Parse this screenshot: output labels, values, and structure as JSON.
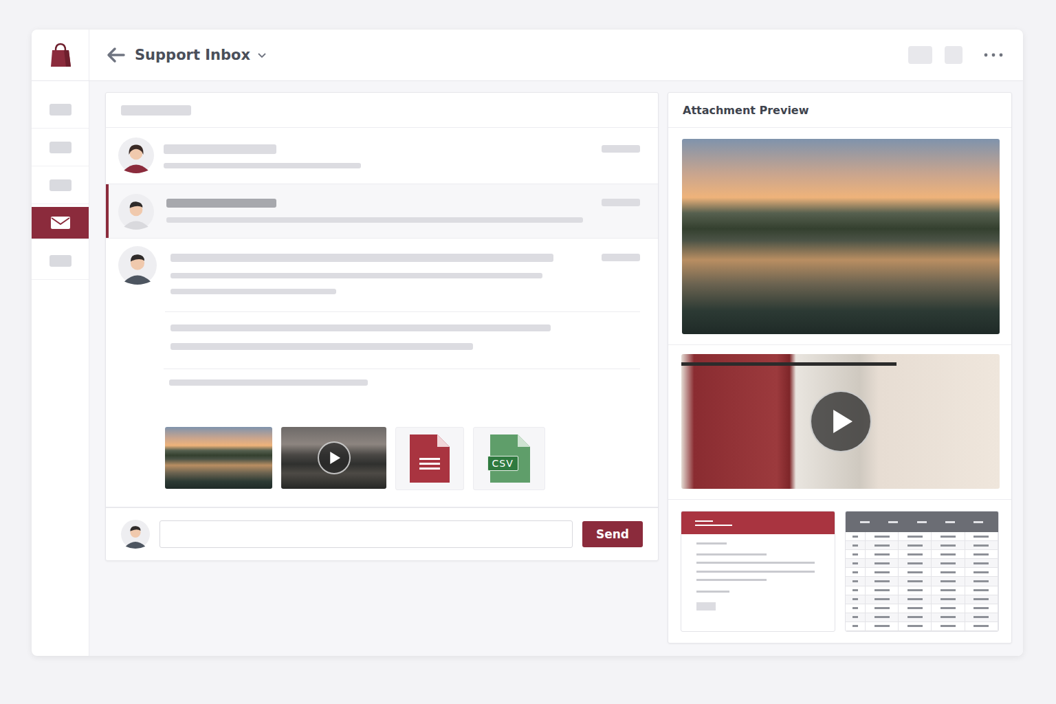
{
  "window": {
    "title": "Support Inbox"
  },
  "sidebar": {
    "items": [
      {
        "selected": false
      },
      {
        "selected": false
      },
      {
        "selected": false
      },
      {
        "selected": true
      },
      {
        "selected": false
      }
    ]
  },
  "conversations": [
    {
      "selected": false,
      "expanded": false
    },
    {
      "selected": true,
      "expanded": false
    },
    {
      "selected": false,
      "expanded": true
    }
  ],
  "message": {
    "attachments": [
      {
        "kind": "image"
      },
      {
        "kind": "video"
      },
      {
        "kind": "document"
      },
      {
        "kind": "csv",
        "label": "CSV"
      }
    ]
  },
  "reply": {
    "placeholder": "",
    "button": "Send"
  },
  "preview": {
    "title": "Attachment Preview",
    "items": [
      {
        "kind": "image"
      },
      {
        "kind": "video"
      },
      {
        "kind": "document"
      },
      {
        "kind": "spreadsheet"
      }
    ]
  }
}
